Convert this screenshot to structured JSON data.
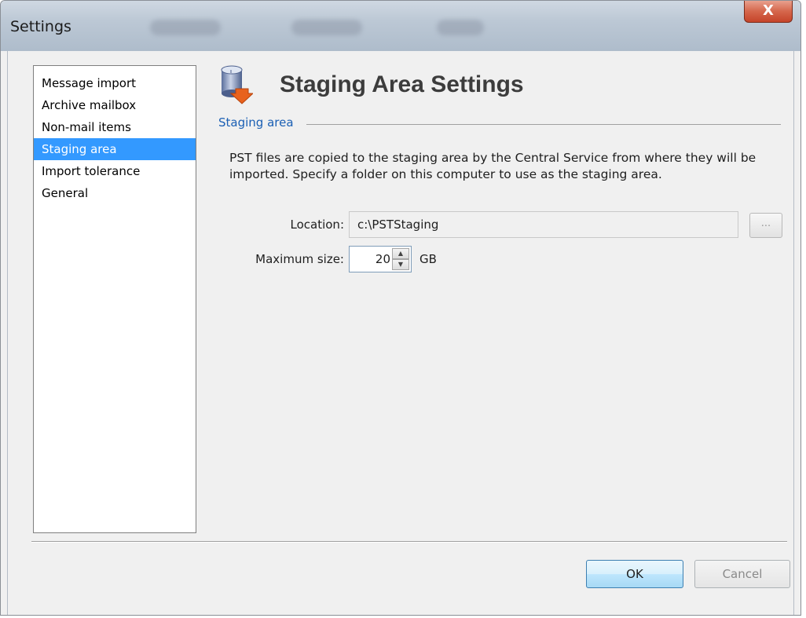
{
  "window": {
    "title": "Settings",
    "close_label": "X"
  },
  "sidebar": {
    "items": [
      {
        "label": "Message import",
        "selected": false
      },
      {
        "label": "Archive mailbox",
        "selected": false
      },
      {
        "label": "Non-mail items",
        "selected": false
      },
      {
        "label": "Staging area",
        "selected": true
      },
      {
        "label": "Import tolerance",
        "selected": false
      },
      {
        "label": "General",
        "selected": false
      }
    ]
  },
  "main": {
    "icon": "database-export-icon",
    "title": "Staging Area Settings",
    "section_label": "Staging area",
    "description": "PST files are copied to the staging area by the Central Service from where they will be imported. Specify a folder on this computer to use as the staging area.",
    "location": {
      "label": "Location:",
      "value": "c:\\PSTStaging",
      "browse_label": "..."
    },
    "max_size": {
      "label": "Maximum size:",
      "value": "20",
      "unit": "GB"
    }
  },
  "footer": {
    "ok_label": "OK",
    "cancel_label": "Cancel"
  },
  "colors": {
    "selection": "#3399ff",
    "section_label": "#1a5fb4",
    "title": "#3c3c3c"
  }
}
